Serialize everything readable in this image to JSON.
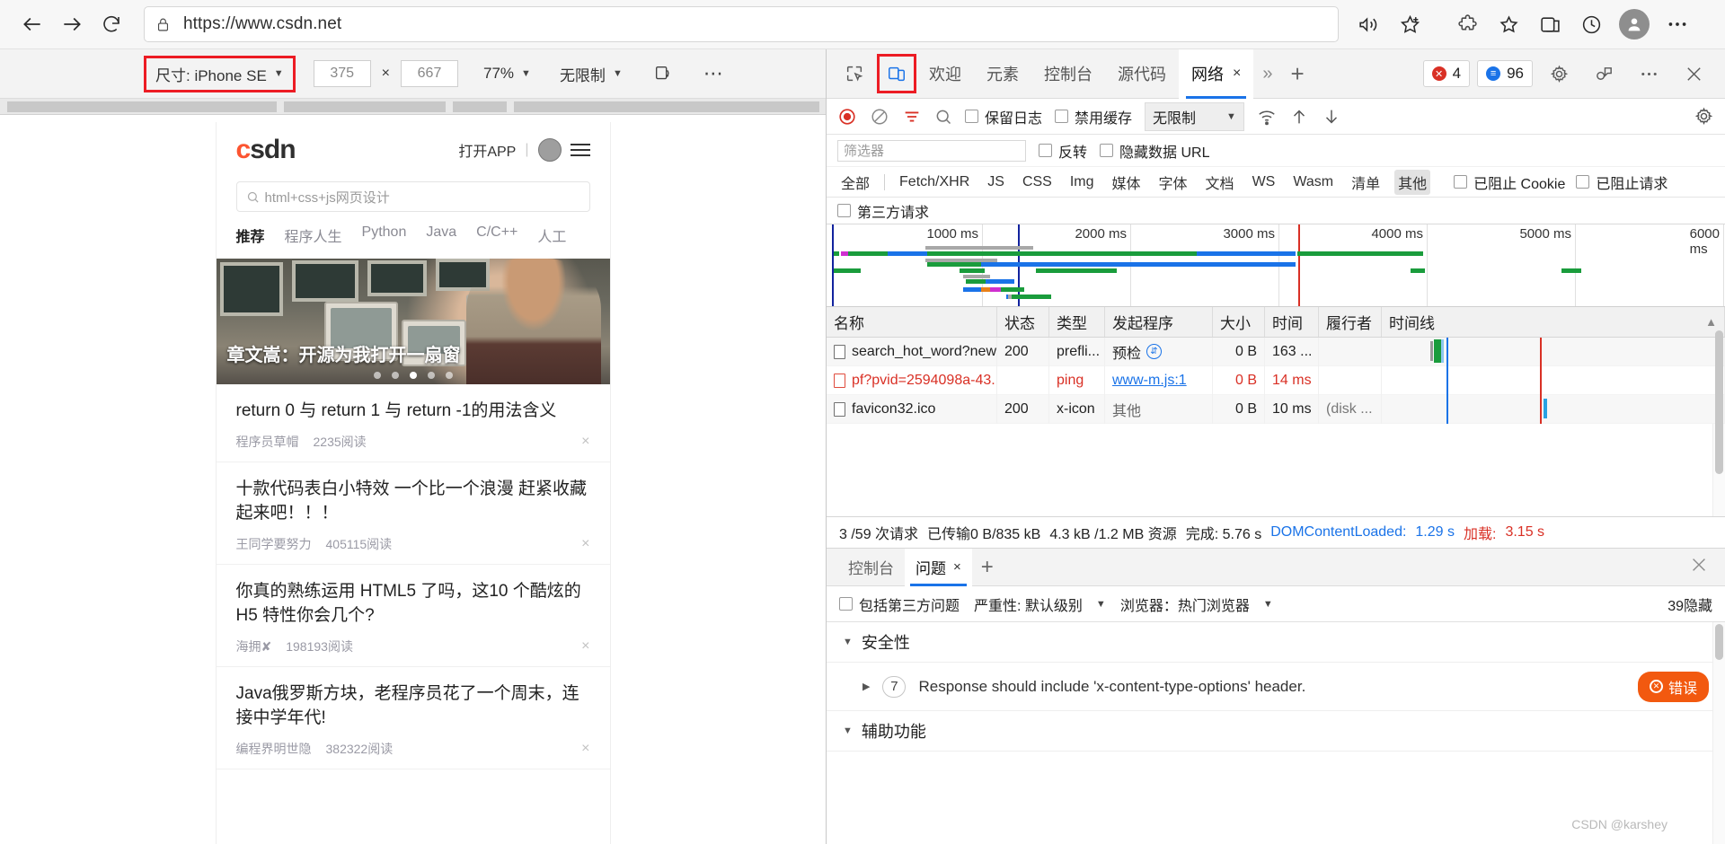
{
  "browser": {
    "url": "https://www.csdn.net",
    "back_icon": "back-arrow-icon",
    "forward_icon": "forward-arrow-icon",
    "reload_icon": "reload-icon",
    "lock_icon": "lock-icon",
    "read_aloud_icon": "read-aloud-icon",
    "favorite_icon": "add-favorite-icon",
    "extensions_icon": "extensions-icon",
    "collections_icon": "collections-icon",
    "browser_essentials_icon": "browser-essentials-icon",
    "history_icon": "history-icon",
    "profile_icon": "profile-icon",
    "settings_icon": "settings-more-icon"
  },
  "device_toolbar": {
    "size_label": "尺寸: iPhone SE",
    "width": "375",
    "height": "667",
    "times": "×",
    "zoom": "77%",
    "throttle": "无限制",
    "rotate_icon": "rotate-device-icon",
    "more_icon": "more-options-icon",
    "highlight_color": "#ec1c24"
  },
  "mobile_page": {
    "logo": "csdn",
    "logo_first_letter": "c",
    "open_app": "打开APP",
    "avatar": "user-avatar",
    "menu_icon": "hamburger-menu-icon",
    "search_placeholder": "html+css+js网页设计",
    "nav": [
      {
        "label": "推荐",
        "active": true
      },
      {
        "label": "程序人生",
        "active": false
      },
      {
        "label": "Python",
        "active": false
      },
      {
        "label": "Java",
        "active": false
      },
      {
        "label": "C/C++",
        "active": false
      },
      {
        "label": "人工",
        "active": false
      }
    ],
    "hero_title": "章文嵩：开源为我打开一扇窗",
    "hero_dots": 5,
    "hero_active_dot": 3,
    "feed": [
      {
        "title": "return 0 与 return 1 与 return -1的用法含义",
        "author": "程序员草帽",
        "reads": "2235阅读"
      },
      {
        "title": "十款代码表白小特效 一个比一个浪漫 赶紧收藏起来吧！！！",
        "author": "王同学要努力",
        "reads": "405115阅读"
      },
      {
        "title": "你真的熟练运用 HTML5 了吗，这10 个酷炫的 H5 特性你会几个?",
        "author": "海拥✘",
        "reads": "198193阅读"
      },
      {
        "title": "Java俄罗斯方块，老程序员花了一个周末，连接中学年代!",
        "author": "编程界明世隐",
        "reads": "382322阅读"
      }
    ],
    "close_glyph": "×"
  },
  "devtools": {
    "inspect_icon": "inspect-element-icon",
    "device_toggle_icon": "toggle-device-emulation-icon",
    "tabs": [
      {
        "label": "欢迎",
        "active": false,
        "closable": false
      },
      {
        "label": "元素",
        "active": false,
        "closable": false
      },
      {
        "label": "控制台",
        "active": false,
        "closable": false
      },
      {
        "label": "源代码",
        "active": false,
        "closable": false
      },
      {
        "label": "网络",
        "active": true,
        "closable": true
      }
    ],
    "more_tabs_icon": "more-tabs-chevron-icon",
    "add_tab_icon": "add-tab-plus-icon",
    "errors_count": "4",
    "messages_count": "96",
    "settings_icon": "gear-icon",
    "customize_icon": "customize-devtools-icon",
    "more_icon": "more-options-icon",
    "close_icon": "close-icon",
    "close_glyph": "×"
  },
  "network_toolbar": {
    "record_icon": "record-stop-icon",
    "clear_icon": "clear-network-icon",
    "filter_icon": "filter-icon",
    "search_icon": "search-icon",
    "preserve_log": "保留日志",
    "disable_cache": "禁用缓存",
    "throttle": "无限制",
    "wifi_icon": "network-conditions-icon",
    "import_icon": "import-har-icon",
    "export_icon": "export-har-icon",
    "settings_icon": "network-settings-gear-icon"
  },
  "network_filter": {
    "filter_placeholder": "筛选器",
    "invert": "反转",
    "hide_data_urls": "隐藏数据 URL",
    "types": [
      {
        "label": "全部",
        "active": false
      },
      {
        "label": "Fetch/XHR",
        "active": false
      },
      {
        "label": "JS",
        "active": false
      },
      {
        "label": "CSS",
        "active": false
      },
      {
        "label": "Img",
        "active": false
      },
      {
        "label": "媒体",
        "active": false
      },
      {
        "label": "字体",
        "active": false
      },
      {
        "label": "文档",
        "active": false
      },
      {
        "label": "WS",
        "active": false
      },
      {
        "label": "Wasm",
        "active": false
      },
      {
        "label": "清单",
        "active": false
      },
      {
        "label": "其他",
        "active": true
      }
    ],
    "blocked_cookies": "已阻止 Cookie",
    "blocked_requests": "已阻止请求",
    "third_party": "第三方请求"
  },
  "overview_chart": {
    "type": "timeline",
    "tick_labels": [
      "1000 ms",
      "2000 ms",
      "3000 ms",
      "4000 ms",
      "5000 ms",
      "6000 ms"
    ],
    "tick_ms": [
      1000,
      2000,
      3000,
      4000,
      5000,
      6000
    ],
    "range_ms": [
      0,
      6300
    ],
    "dcl_marker_ms": 1290,
    "load_marker_ms": 3150,
    "dcl_color": "#1a1a8c",
    "load_color": "#d93025"
  },
  "network_table": {
    "columns": [
      "名称",
      "状态",
      "类型",
      "发起程序",
      "大小",
      "时间",
      "履行者",
      "时间线"
    ],
    "sort_icon": "sort-ascending-icon",
    "rows": [
      {
        "name": "search_hot_word?new...",
        "status": "200",
        "type": "prefli...",
        "initiator": "预检",
        "initiator_icon": "preflight-arrows-icon",
        "size": "0 B",
        "time": "163 ...",
        "fulfilled_by": "",
        "error": false
      },
      {
        "name": "pf?pvid=2594098a-43...",
        "status": "",
        "type": "ping",
        "initiator": "www-m.js:1",
        "initiator_link": true,
        "size": "0 B",
        "time": "14 ms",
        "fulfilled_by": "",
        "error": true
      },
      {
        "name": "favicon32.ico",
        "status": "200",
        "type": "x-icon",
        "initiator": "其他",
        "size": "0 B",
        "time": "10 ms",
        "fulfilled_by": "(disk ...",
        "error": false
      }
    ]
  },
  "network_status": {
    "requests": "3 /59 次请求",
    "transferred": "已传输0 B/835 kB",
    "resources": "4.3 kB /1.2 MB 资源",
    "finish": "完成: 5.76 s",
    "dcl_label": "DOMContentLoaded:",
    "dcl_value": "1.29 s",
    "load_label": "加载:",
    "load_value": "3.15 s"
  },
  "drawer": {
    "tabs": [
      {
        "label": "控制台",
        "active": false,
        "closable": false
      },
      {
        "label": "问题",
        "active": true,
        "closable": true
      }
    ],
    "add_tab_icon": "add-tab-plus-icon",
    "close_icon": "close-drawer-icon",
    "close_glyph": "×",
    "include_third_party": "包括第三方问题",
    "severity": "严重性: 默认级别",
    "browser": "浏览器：热门浏览器",
    "hidden_count": "39隐藏",
    "groups": [
      {
        "title": "安全性",
        "expanded": true,
        "issues": [
          {
            "count": "7",
            "text": "Response should include 'x-content-type-options' header.",
            "badge": "错误",
            "badge_color": "#f2590f"
          }
        ]
      },
      {
        "title": "辅助功能",
        "expanded": true,
        "issues": []
      }
    ]
  },
  "watermark": "CSDN @karshey"
}
